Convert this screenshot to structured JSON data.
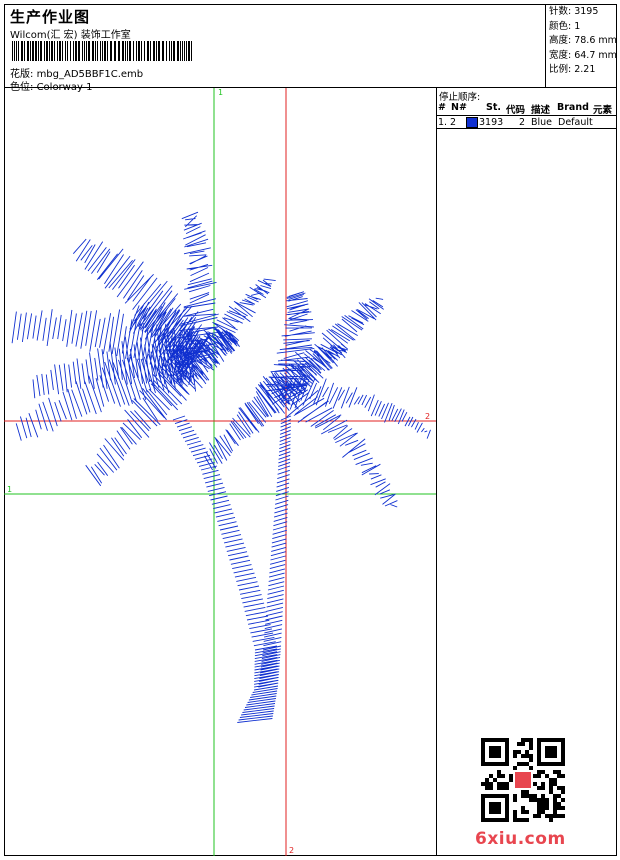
{
  "header": {
    "title": "生产作业图",
    "company": "Wilcom(汇 宏) 装饰工作室",
    "file_label": "花版:",
    "file_name": "mbg_AD5BBF1C.emb",
    "colorway_label": "色位:",
    "colorway_name": "Colorway 1"
  },
  "stats": {
    "stitches": "针数: 3195",
    "colors": "颜色: 1",
    "height": "高度: 78.6 mm",
    "width": "宽度: 64.7 mm",
    "scale": "比例: 2.21"
  },
  "stop_sequence": {
    "title": "停止顺序:",
    "headers": {
      "index": "#",
      "needle": "N#",
      "stitches": "St.",
      "code": "代码",
      "description": "描述",
      "brand": "Brand",
      "elements": "元素"
    },
    "rows": [
      {
        "index": "1.",
        "needle": "2",
        "stitches": "3193",
        "code": "2",
        "description": "Blue",
        "brand": "Default",
        "color": "#1030d0"
      }
    ]
  },
  "guides": {
    "green_top": "1",
    "green_left": "1",
    "red_right": "2",
    "red_bottom": "2"
  },
  "watermark": {
    "site": "6xiu.com"
  },
  "colors": {
    "thread": "#1030d0",
    "green_guide": "#22c322",
    "red_guide": "#e02020",
    "watermark": "#e8464f"
  },
  "design": {
    "subject": "palm-tree-embroidery"
  }
}
